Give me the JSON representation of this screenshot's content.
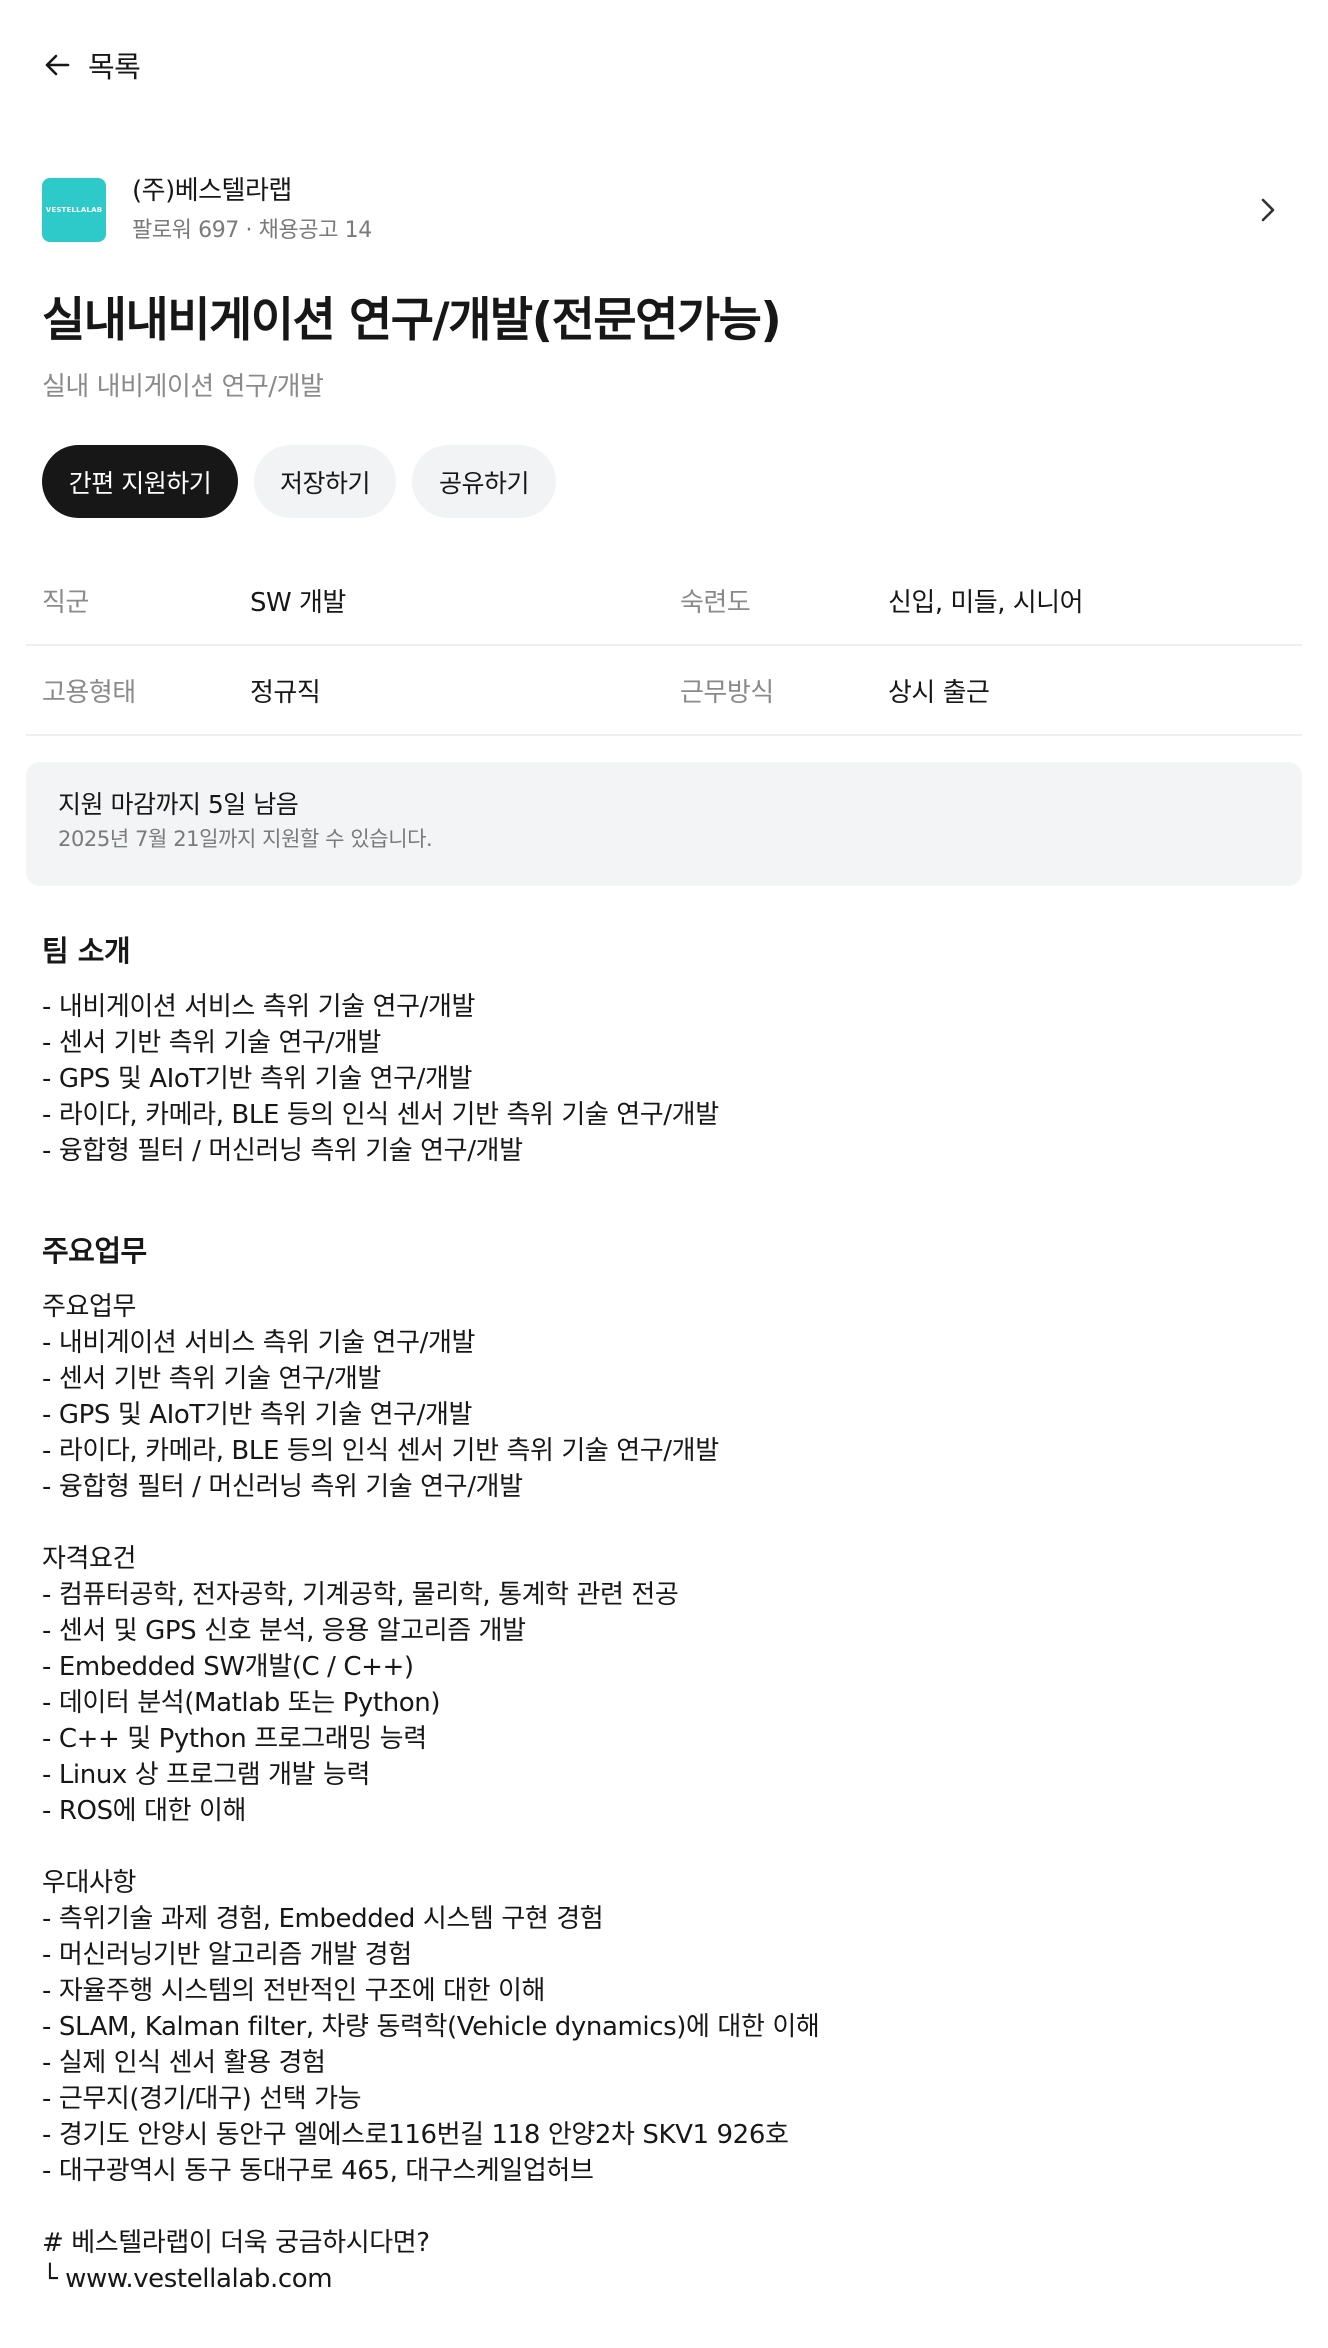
{
  "nav": {
    "back_label": "목록"
  },
  "company": {
    "logo_text": "VESTELLALAB",
    "name": "(주)베스텔라랩",
    "meta": "팔로워 697 · 채용공고 14"
  },
  "job": {
    "title": "실내내비게이션 연구/개발(전문연가능)",
    "subtitle": "실내 내비게이션 연구/개발"
  },
  "actions": {
    "apply_label": "간편 지원하기",
    "save_label": "저장하기",
    "share_label": "공유하기"
  },
  "info": {
    "rows": [
      {
        "label1": "직군",
        "value1": "SW 개발",
        "label2": "숙련도",
        "value2": "신입, 미들, 시니어"
      },
      {
        "label1": "고용형태",
        "value1": "정규직",
        "label2": "근무방식",
        "value2": "상시 출근"
      }
    ]
  },
  "deadline": {
    "title": "지원 마감까지 5일 남음",
    "subtitle": "2025년 7월 21일까지 지원할 수 있습니다."
  },
  "team": {
    "heading": "팀 소개",
    "lines": [
      "- 내비게이션 서비스 측위 기술 연구/개발",
      "- 센서 기반 측위 기술 연구/개발",
      "- GPS 및 AIoT기반 측위 기술 연구/개발",
      "- 라이다, 카메라, BLE 등의 인식 센서 기반 측위 기술 연구/개발",
      "- 융합형 필터 / 머신러닝 측위 기술 연구/개발"
    ]
  },
  "duties": {
    "heading": "주요업무",
    "lines": [
      "주요업무",
      "- 내비게이션 서비스 측위 기술 연구/개발",
      "- 센서 기반 측위 기술 연구/개발",
      "- GPS 및 AIoT기반 측위 기술 연구/개발",
      "- 라이다, 카메라, BLE 등의 인식 센서 기반 측위 기술 연구/개발",
      "- 융합형 필터 / 머신러닝 측위 기술 연구/개발",
      "",
      "자격요건",
      "- 컴퓨터공학, 전자공학, 기계공학, 물리학, 통계학 관련 전공",
      "- 센서 및 GPS 신호 분석, 응용 알고리즘 개발",
      "- Embedded SW개발(C / C++)",
      "- 데이터 분석(Matlab 또는 Python)",
      "- C++ 및 Python 프로그래밍 능력",
      "- Linux 상 프로그램 개발 능력",
      "- ROS에 대한 이해",
      "",
      "우대사항",
      "- 측위기술 과제 경험, Embedded 시스템 구현 경험",
      "- 머신러닝기반 알고리즘 개발 경험",
      "- 자율주행 시스템의 전반적인 구조에 대한 이해",
      "- SLAM, Kalman filter, 차량 동력학(Vehicle dynamics)에 대한 이해",
      "- 실제 인식 센서 활용 경험",
      "- 근무지(경기/대구) 선택 가능",
      "- 경기도 안양시 동안구 엘에스로116번길 118 안양2차 SKV1 926호",
      "- 대구광역시 동구 동대구로 465, 대구스케일업허브",
      "",
      "# 베스텔라랩이 더욱 궁금하시다면?",
      "└ www.vestellalab.com"
    ]
  }
}
